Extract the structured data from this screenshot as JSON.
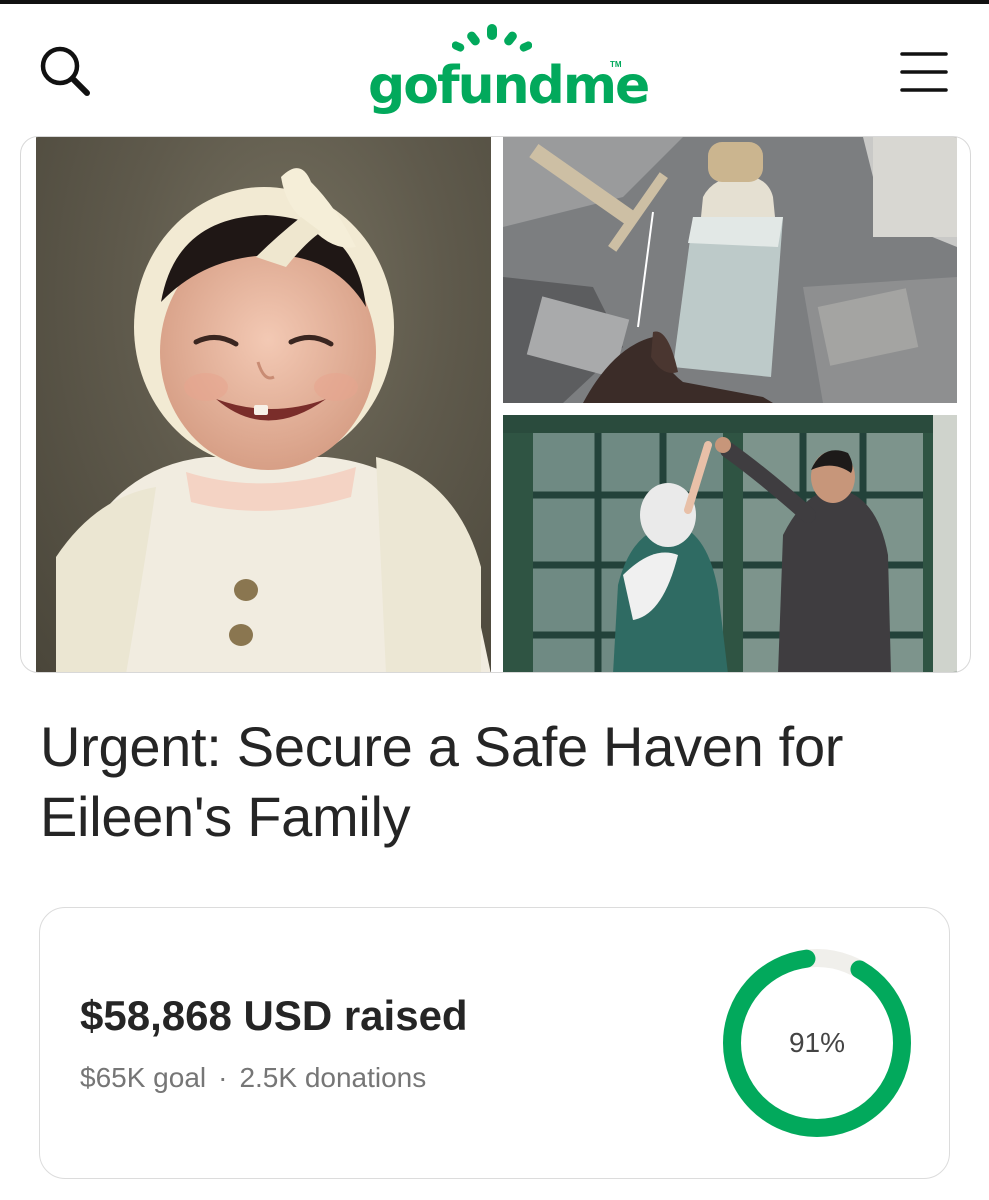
{
  "app": {
    "logo_text": "gofundme",
    "logo_tm": "TM"
  },
  "header": {
    "search_icon": "search-icon",
    "menu_icon": "hamburger-menu-icon"
  },
  "campaign": {
    "title": "Urgent: Secure a Safe Haven for Eileen's Family",
    "photos": [
      "smiling-toddler-photo",
      "baby-bottle-in-rubble-photo",
      "couple-at-window-photo"
    ]
  },
  "progress": {
    "raised_text": "$58,868 USD raised",
    "goal_text": "$65K goal",
    "separator": "·",
    "donations_text": "2.5K donations",
    "percent_label": "91%",
    "percent_value": 0.91
  },
  "colors": {
    "brand": "#02a95c",
    "ring_track": "#f0efeb",
    "text": "#252525",
    "muted": "#767676"
  }
}
